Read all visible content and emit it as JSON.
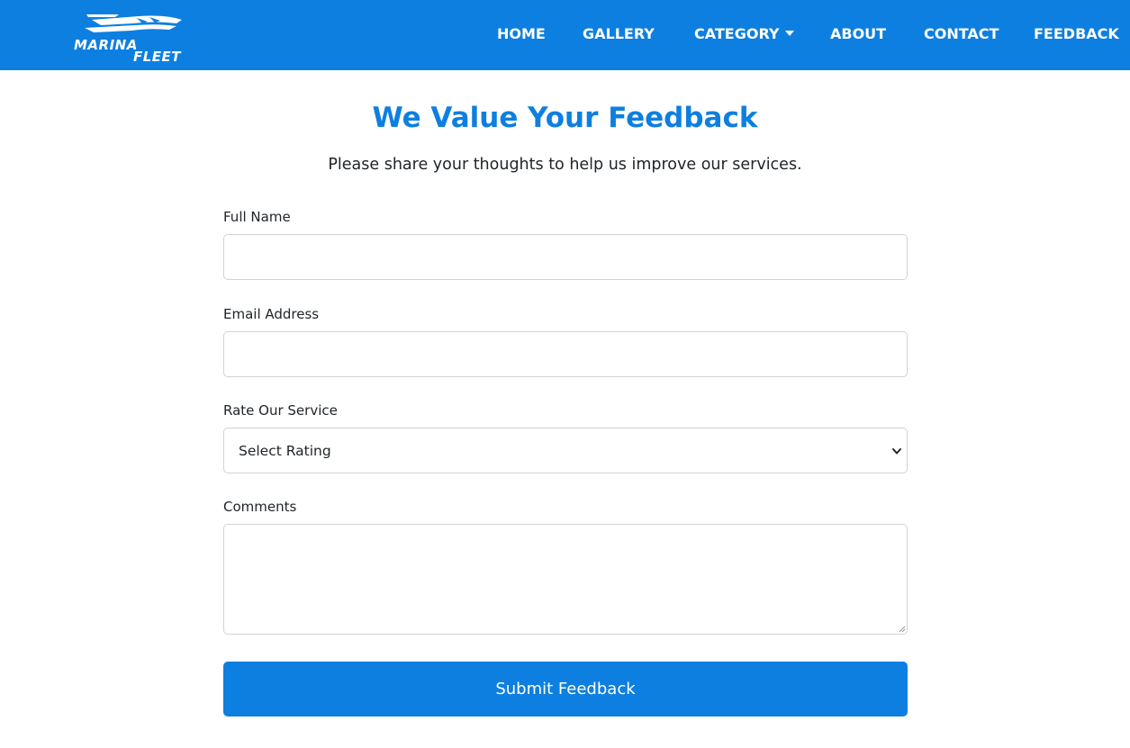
{
  "brand": {
    "line1": "MARINA",
    "line2": "FLEET",
    "color": "#0d7fe0"
  },
  "nav": {
    "home": "HOME",
    "gallery": "GALLERY",
    "category": "CATEGORY",
    "about": "ABOUT",
    "contact": "CONTACT",
    "feedback": "FEEDBACK"
  },
  "page": {
    "title": "We Value Your Feedback",
    "subtitle": "Please share your thoughts to help us improve our services."
  },
  "form": {
    "full_name_label": "Full Name",
    "full_name_value": "",
    "email_label": "Email Address",
    "email_value": "",
    "rating_label": "Rate Our Service",
    "rating_selected": "Select Rating",
    "comments_label": "Comments",
    "comments_value": "",
    "submit_label": "Submit Feedback"
  },
  "icons": {
    "logo": "boat-logo-icon",
    "category_caret": "caret-down-icon",
    "select_chevron": "chevron-down-icon",
    "textarea_grip": "resize-grip-icon"
  }
}
